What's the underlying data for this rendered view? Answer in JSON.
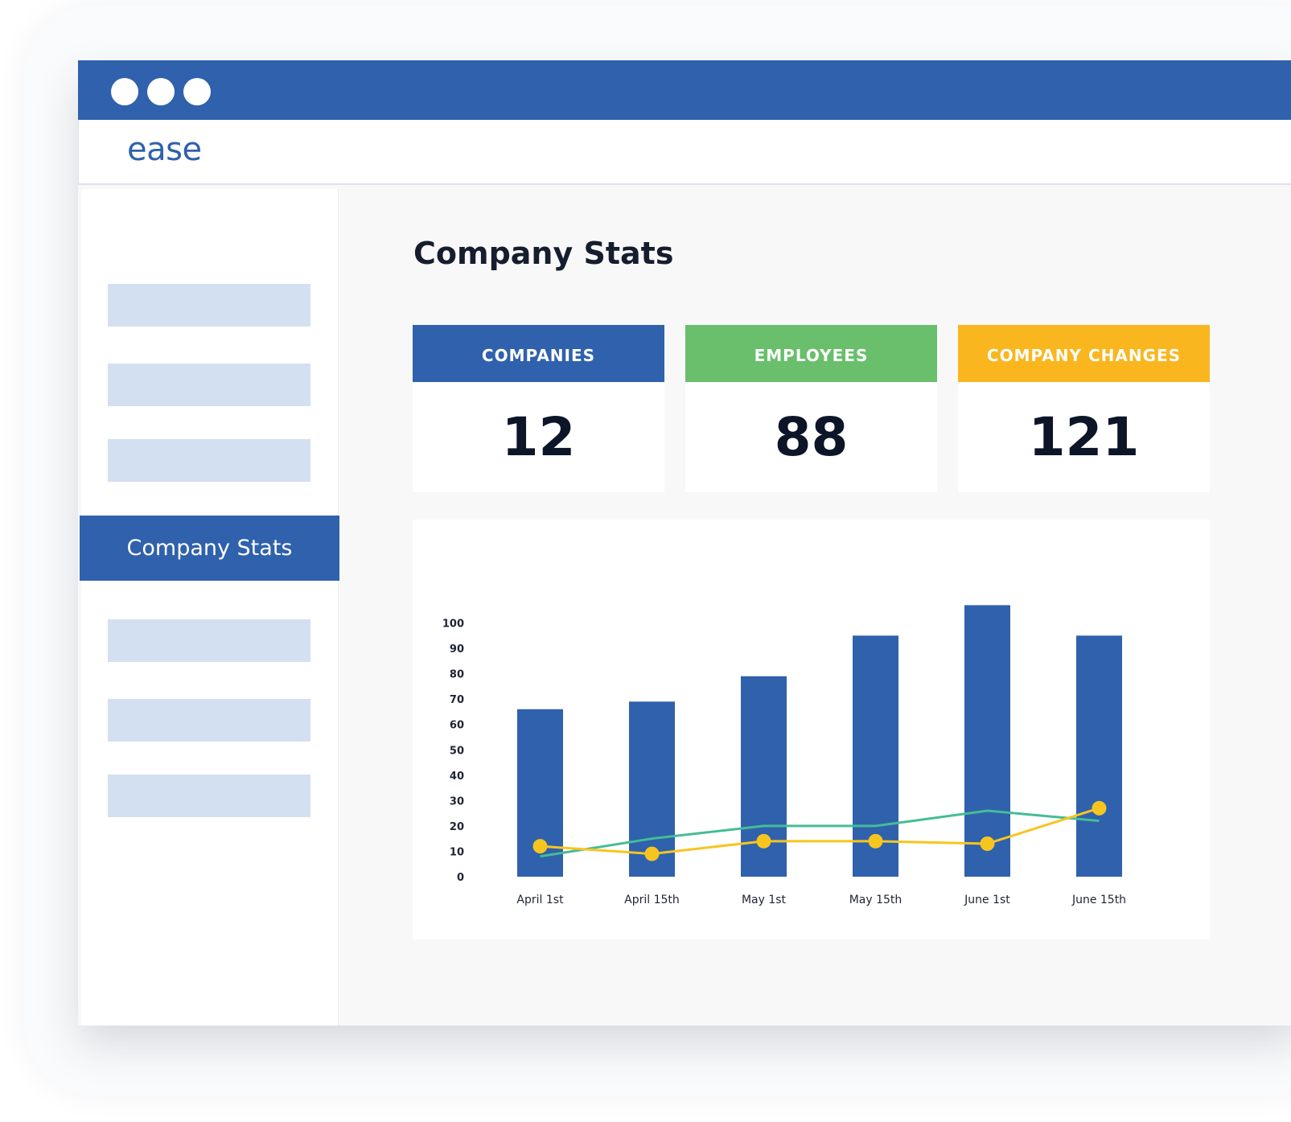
{
  "app": {
    "logo": "ease"
  },
  "sidebar": {
    "active_item": "Company Stats"
  },
  "main": {
    "title": "Company Stats",
    "stats": [
      {
        "label": "COMPANIES",
        "value": "12",
        "color": "#2f61ac"
      },
      {
        "label": "EMPLOYEES",
        "value": "88",
        "color": "#69bf6b"
      },
      {
        "label": "COMPANY CHANGES",
        "value": "121",
        "color": "#f9b61e"
      }
    ]
  },
  "chart_data": {
    "type": "bar",
    "categories": [
      "April 1st",
      "April 15th",
      "May 1st",
      "May 15th",
      "June 1st",
      "June 15th"
    ],
    "ylim": [
      0,
      100
    ],
    "yticks": [
      0,
      10,
      20,
      30,
      40,
      50,
      60,
      70,
      80,
      90,
      100
    ],
    "grid": false,
    "series": [
      {
        "type": "bar",
        "color": "#2f61ac",
        "values": [
          66,
          69,
          79,
          95,
          107,
          95
        ]
      },
      {
        "type": "line",
        "color": "#45bc96",
        "values": [
          8,
          15,
          20,
          20,
          26,
          22
        ]
      },
      {
        "type": "line",
        "color": "#f7c51f",
        "markers": true,
        "values": [
          12,
          9,
          14,
          14,
          13,
          27
        ]
      }
    ]
  }
}
